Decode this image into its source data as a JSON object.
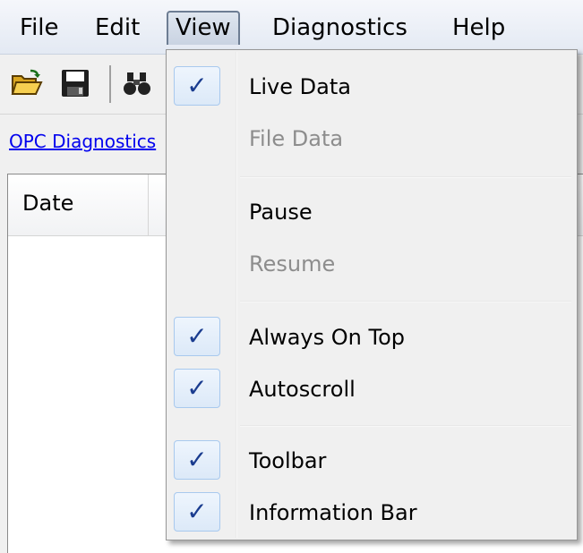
{
  "menubar": {
    "items": [
      {
        "label": "File"
      },
      {
        "label": "Edit"
      },
      {
        "label": "View"
      },
      {
        "label": "Diagnostics"
      },
      {
        "label": "Help"
      }
    ]
  },
  "toolbar": {
    "icons": [
      "open-folder-icon",
      "save-icon",
      "binoculars-icon"
    ]
  },
  "infobar": {
    "link_text": "OPC Diagnostics"
  },
  "list": {
    "columns": [
      "Date"
    ]
  },
  "view_menu": {
    "items": [
      {
        "label": "Live Data",
        "checked": true,
        "enabled": true
      },
      {
        "label": "File Data",
        "checked": false,
        "enabled": false
      },
      {
        "label": "Pause",
        "checked": false,
        "enabled": true
      },
      {
        "label": "Resume",
        "checked": false,
        "enabled": false
      },
      {
        "label": "Always On Top",
        "checked": true,
        "enabled": true
      },
      {
        "label": "Autoscroll",
        "checked": true,
        "enabled": true
      },
      {
        "label": "Toolbar",
        "checked": true,
        "enabled": true
      },
      {
        "label": "Information Bar",
        "checked": true,
        "enabled": true
      }
    ],
    "check_glyph": "✓"
  },
  "colors": {
    "link": "#0000ee",
    "check": "#1a3c8f",
    "disabled_text": "#8d8d8d"
  }
}
